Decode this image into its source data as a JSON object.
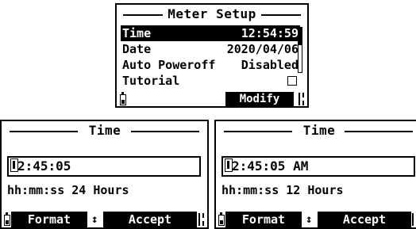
{
  "meter_setup": {
    "title": "Meter Setup",
    "items": [
      {
        "label": "Time",
        "value": "12:54:59",
        "selected": true
      },
      {
        "label": "Date",
        "value": "2020/04/06",
        "selected": false
      },
      {
        "label": "Auto Poweroff",
        "value": "Disabled",
        "selected": false
      },
      {
        "label": "Tutorial",
        "value": "",
        "checkbox": true,
        "checked": false,
        "selected": false
      }
    ],
    "softkey": "Modify"
  },
  "time_24h": {
    "title": "Time",
    "value_rest": "2:45:05",
    "format_label": "hh:mm:ss 24 Hours",
    "softkey_left": "Format",
    "softkey_right": "Accept",
    "updown_symbol": "↕"
  },
  "time_12h": {
    "title": "Time",
    "value_rest": "2:45:05 AM",
    "format_label": "hh:mm:ss 12 Hours",
    "softkey_left": "Format",
    "softkey_right": "Accept",
    "updown_symbol": "↕"
  },
  "icons": {
    "battery": "battery-icon",
    "keylock": "keylock-icon",
    "scrollbar": "scrollbar",
    "cursor": "edit-cursor-icon"
  }
}
